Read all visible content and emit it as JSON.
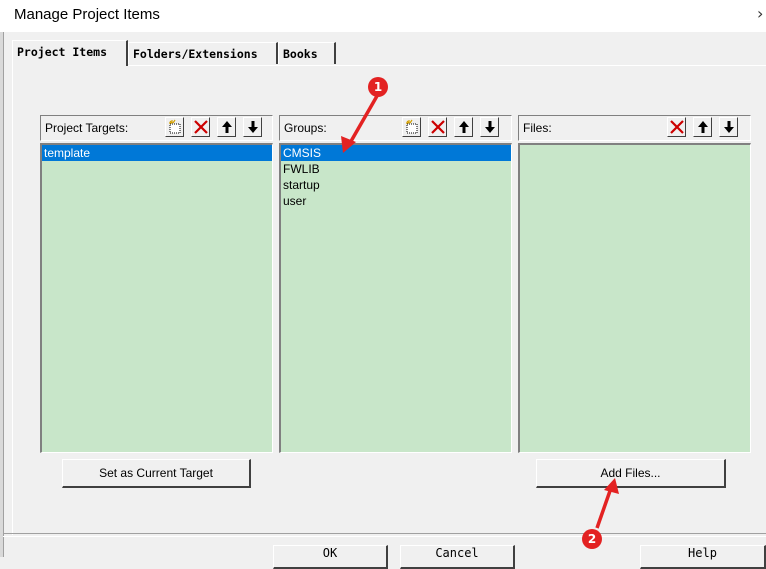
{
  "window": {
    "title": "Manage Project Items",
    "close_glyph": "›"
  },
  "tabs": [
    {
      "label": "Project Items",
      "active": true
    },
    {
      "label": "Folders/Extensions",
      "active": false
    },
    {
      "label": "Books",
      "active": false
    }
  ],
  "targets": {
    "label": "Project Targets:",
    "items": [
      "template"
    ],
    "selected_index": 0,
    "tools": [
      "new-icon",
      "delete-icon",
      "move-up-icon",
      "move-down-icon"
    ]
  },
  "groups": {
    "label": "Groups:",
    "items": [
      "CMSIS",
      "FWLIB",
      "startup",
      "user"
    ],
    "selected_index": 0,
    "tools": [
      "new-icon",
      "delete-icon",
      "move-up-icon",
      "move-down-icon"
    ]
  },
  "files": {
    "label": "Files:",
    "items": [],
    "tools": [
      "delete-icon",
      "move-up-icon",
      "move-down-icon"
    ]
  },
  "buttons": {
    "set_current_target": "Set as Current Target",
    "add_files": "Add Files...",
    "ok": "OK",
    "cancel": "Cancel",
    "help": "Help"
  },
  "annotations": {
    "badge_1": "1",
    "badge_2": "2",
    "color": "#e32222"
  },
  "colors": {
    "list_background": "#c8e6c9",
    "selection": "#0078d7",
    "dialog": "#f0f0f0"
  }
}
